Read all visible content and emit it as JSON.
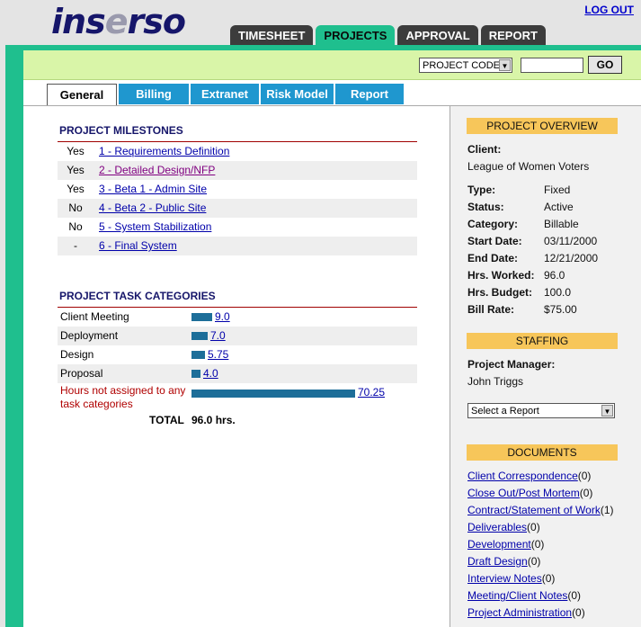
{
  "header": {
    "logo_main": "ins",
    "logo_e": "e",
    "logo_tail": "rso",
    "logout": "LOG OUT",
    "tabs": [
      "TIMESHEET",
      "PROJECTS",
      "APPROVAL",
      "REPORT"
    ]
  },
  "search": {
    "select_value": "PROJECT CODE",
    "input_value": "",
    "go": "GO"
  },
  "subtabs": [
    "General",
    "Billing",
    "Extranet",
    "Risk Model",
    "Report"
  ],
  "milestones": {
    "title": "PROJECT MILESTONES",
    "rows": [
      {
        "status": "Yes",
        "label": "1 - Requirements Definition"
      },
      {
        "status": "Yes",
        "label": "2 - Detailed Design/NFP"
      },
      {
        "status": "Yes",
        "label": "3 - Beta 1 - Admin Site"
      },
      {
        "status": "No",
        "label": "4 - Beta 2 - Public Site"
      },
      {
        "status": "No",
        "label": "5 - System Stabilization"
      },
      {
        "status": "-",
        "label": "6 - Final System"
      }
    ]
  },
  "tasks": {
    "title": "PROJECT TASK CATEGORIES",
    "rows": [
      {
        "name": "Client Meeting",
        "hours": "9.0",
        "value": 9.0
      },
      {
        "name": "Deployment",
        "hours": "7.0",
        "value": 7.0
      },
      {
        "name": "Design",
        "hours": "5.75",
        "value": 5.75
      },
      {
        "name": "Proposal",
        "hours": "4.0",
        "value": 4.0
      }
    ],
    "unassigned_label": "Hours not assigned to any task categories",
    "unassigned_hours": "70.25",
    "unassigned_value": 70.25,
    "total_label": "TOTAL",
    "total_value": "96.0 hrs."
  },
  "overview": {
    "title": "PROJECT OVERVIEW",
    "client_label": "Client:",
    "client_value": "League of Women Voters",
    "fields": [
      {
        "label": "Type:",
        "value": "Fixed"
      },
      {
        "label": "Status:",
        "value": "Active"
      },
      {
        "label": "Category:",
        "value": "Billable"
      },
      {
        "label": "Start Date:",
        "value": "03/11/2000"
      },
      {
        "label": "End Date:",
        "value": "12/21/2000"
      },
      {
        "label": "Hrs. Worked:",
        "value": "96.0"
      },
      {
        "label": "Hrs. Budget:",
        "value": "100.0"
      },
      {
        "label": "Bill Rate:",
        "value": "$75.00"
      }
    ]
  },
  "staffing": {
    "title": "STAFFING",
    "pm_label": "Project Manager:",
    "pm_value": "John Triggs",
    "report_select": "Select a Report"
  },
  "documents": {
    "title": "DOCUMENTS",
    "items": [
      {
        "name": "Client Correspondence",
        "count": "(0)"
      },
      {
        "name": "Close Out/Post Mortem",
        "count": "(0)"
      },
      {
        "name": "Contract/Statement of Work",
        "count": "(1)"
      },
      {
        "name": "Deliverables",
        "count": "(0)"
      },
      {
        "name": "Development",
        "count": "(0)"
      },
      {
        "name": "Draft Design",
        "count": "(0)"
      },
      {
        "name": "Interview Notes",
        "count": "(0)"
      },
      {
        "name": "Meeting/Client Notes",
        "count": "(0)"
      },
      {
        "name": "Project Administration",
        "count": "(0)"
      }
    ]
  }
}
